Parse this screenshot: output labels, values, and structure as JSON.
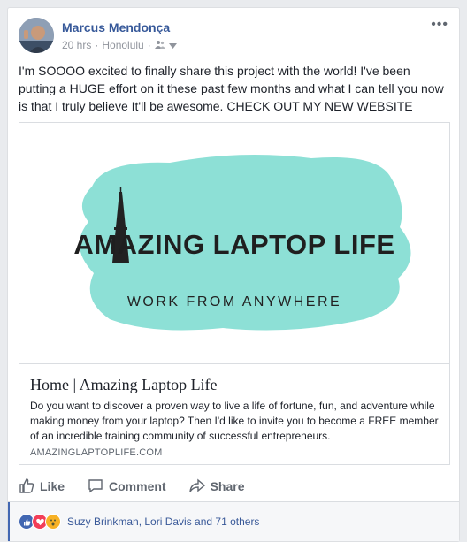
{
  "post": {
    "author": "Marcus Mendonça",
    "time": "20 hrs",
    "location": "Honolulu",
    "text": "I'm SOOOO excited to finally share this project with the world! I've been putting a HUGE effort on it these past few months and what I can tell you now is that I truly believe It'll be awesome. CHECK OUT MY NEW WEBSITE"
  },
  "link_preview": {
    "logo_title": "AMAZING LAPTOP LIFE",
    "logo_subtitle": "WORK FROM ANYWHERE",
    "title": "Home | Amazing Laptop Life",
    "description": "Do you want to discover a proven way to live a life of fortune, fun, and adventure while making money from your laptop? Then I'd like to invite you to become a FREE member of an incredible training community of successful entrepreneurs.",
    "domain": "AMAZINGLAPTOPLIFE.COM"
  },
  "actions": {
    "like": "Like",
    "comment": "Comment",
    "share": "Share"
  },
  "reactions": {
    "summary": "Suzy Brinkman, Lori Davis and 71 others"
  },
  "colors": {
    "accent": "#365899",
    "splash": "#8de0d6"
  }
}
